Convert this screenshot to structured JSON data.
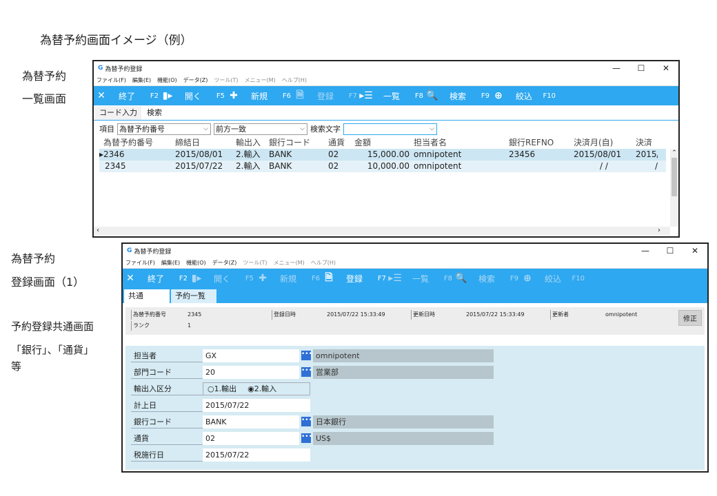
{
  "heading": "為替予約画面イメージ（例）",
  "side_labels": {
    "list_line1": "為替予約",
    "list_line2": "一覧画面",
    "reg_line1": "為替予約",
    "reg_line2": "登録画面（1）",
    "note_line1": "予約登録共通画面",
    "note_line2": "「銀行」、「通貨」",
    "note_line3": "等"
  },
  "window": {
    "title": "為替予約登録",
    "menu": [
      "ファイル(F)",
      "編集(E)",
      "機能(O)",
      "データ(Z)",
      "ツール(T)",
      "メニュー(M)",
      "ヘルプ(H)"
    ],
    "controls": {
      "minimize": "—",
      "maximize": "☐",
      "close": "✕"
    }
  },
  "toolbar": {
    "exit": {
      "icon": "✕",
      "label": "終了",
      "key": "F2"
    },
    "open": {
      "icon": "▮▸",
      "label": "開く",
      "key": "F5"
    },
    "new": {
      "icon": "✚",
      "label": "新規",
      "key": "F6"
    },
    "register": {
      "icon": "🗎",
      "label": "登録",
      "key": "F7"
    },
    "list": {
      "icon": "▸☰",
      "label": "一覧",
      "key": "F8"
    },
    "search": {
      "icon": "🔍",
      "label": "検索",
      "key": "F9"
    },
    "narrow": {
      "icon": "⊕",
      "label": "絞込",
      "key": "F10"
    }
  },
  "list_screen": {
    "tabs": [
      "コード入力",
      "検索"
    ],
    "filter": {
      "item_label": "項目",
      "item_value": "為替予約番号",
      "match_value": "前方一致",
      "search_label": "検索文字",
      "search_value": ""
    },
    "columns": [
      "為替予約番号",
      "締結日",
      "輸出入",
      "銀行コード",
      "通貨",
      "金額",
      "担当者名",
      "銀行REFNO",
      "決済月(自)",
      "決済"
    ],
    "rows": [
      [
        "2346",
        "2015/08/01",
        "2.輸入",
        "BANK",
        "02",
        "15,000.00",
        "omnipotent",
        "23456",
        "2015/08/01",
        "2015/"
      ],
      [
        "2345",
        "2015/07/22",
        "2.輸入",
        "BANK",
        "02",
        "10,000.00",
        "omnipotent",
        "",
        "  /  /",
        "/"
      ]
    ],
    "row_marker": "▸"
  },
  "reg_screen": {
    "tabs": [
      "共通",
      "予約一覧"
    ],
    "info": {
      "no_label": "為替予約番号",
      "no_value": "2345",
      "rank_label": "ランク",
      "rank_value": "1",
      "reg_label": "登録日時",
      "reg_value": "2015/07/22 15:33:49",
      "upd_label": "更新日時",
      "upd_value": "2015/07/22 15:33:49",
      "user_label": "更新者",
      "user_value": "omnipotent",
      "edit_button": "修正"
    },
    "fields": {
      "tanto": {
        "label": "担当者",
        "value": "GX",
        "desc": "omnipotent"
      },
      "bumon": {
        "label": "部門コード",
        "value": "20",
        "desc": "営業部"
      },
      "yushutsu": {
        "label": "輸出入区分",
        "opt1": "○1.輸出",
        "opt2": "◉2.輸入"
      },
      "keijo": {
        "label": "計上日",
        "value": "2015/07/22"
      },
      "bank": {
        "label": "銀行コード",
        "value": "BANK",
        "desc": "日本銀行"
      },
      "currency": {
        "label": "通貨",
        "value": "02",
        "desc": "US$"
      },
      "tax": {
        "label": "税施行日",
        "value": "2015/07/22"
      }
    },
    "lookup_glyph": "•••"
  }
}
